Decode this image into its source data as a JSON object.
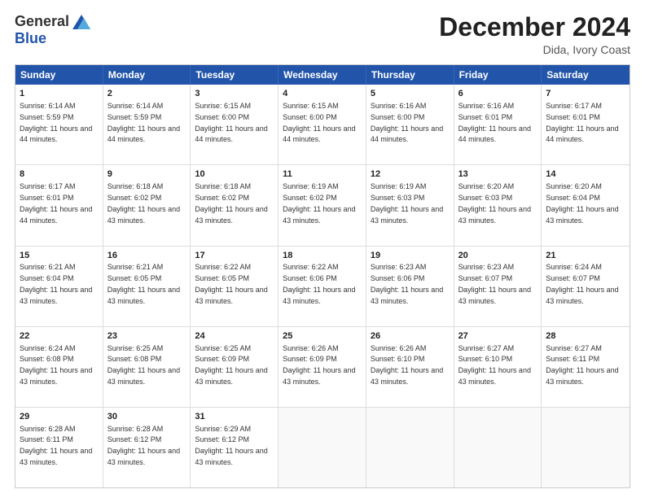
{
  "logo": {
    "general": "General",
    "blue": "Blue"
  },
  "title": "December 2024",
  "location": "Dida, Ivory Coast",
  "days": [
    "Sunday",
    "Monday",
    "Tuesday",
    "Wednesday",
    "Thursday",
    "Friday",
    "Saturday"
  ],
  "weeks": [
    [
      {
        "day": "1",
        "sunrise": "6:14 AM",
        "sunset": "5:59 PM",
        "daylight": "11 hours and 44 minutes."
      },
      {
        "day": "2",
        "sunrise": "6:14 AM",
        "sunset": "5:59 PM",
        "daylight": "11 hours and 44 minutes."
      },
      {
        "day": "3",
        "sunrise": "6:15 AM",
        "sunset": "6:00 PM",
        "daylight": "11 hours and 44 minutes."
      },
      {
        "day": "4",
        "sunrise": "6:15 AM",
        "sunset": "6:00 PM",
        "daylight": "11 hours and 44 minutes."
      },
      {
        "day": "5",
        "sunrise": "6:16 AM",
        "sunset": "6:00 PM",
        "daylight": "11 hours and 44 minutes."
      },
      {
        "day": "6",
        "sunrise": "6:16 AM",
        "sunset": "6:01 PM",
        "daylight": "11 hours and 44 minutes."
      },
      {
        "day": "7",
        "sunrise": "6:17 AM",
        "sunset": "6:01 PM",
        "daylight": "11 hours and 44 minutes."
      }
    ],
    [
      {
        "day": "8",
        "sunrise": "6:17 AM",
        "sunset": "6:01 PM",
        "daylight": "11 hours and 44 minutes."
      },
      {
        "day": "9",
        "sunrise": "6:18 AM",
        "sunset": "6:02 PM",
        "daylight": "11 hours and 43 minutes."
      },
      {
        "day": "10",
        "sunrise": "6:18 AM",
        "sunset": "6:02 PM",
        "daylight": "11 hours and 43 minutes."
      },
      {
        "day": "11",
        "sunrise": "6:19 AM",
        "sunset": "6:02 PM",
        "daylight": "11 hours and 43 minutes."
      },
      {
        "day": "12",
        "sunrise": "6:19 AM",
        "sunset": "6:03 PM",
        "daylight": "11 hours and 43 minutes."
      },
      {
        "day": "13",
        "sunrise": "6:20 AM",
        "sunset": "6:03 PM",
        "daylight": "11 hours and 43 minutes."
      },
      {
        "day": "14",
        "sunrise": "6:20 AM",
        "sunset": "6:04 PM",
        "daylight": "11 hours and 43 minutes."
      }
    ],
    [
      {
        "day": "15",
        "sunrise": "6:21 AM",
        "sunset": "6:04 PM",
        "daylight": "11 hours and 43 minutes."
      },
      {
        "day": "16",
        "sunrise": "6:21 AM",
        "sunset": "6:05 PM",
        "daylight": "11 hours and 43 minutes."
      },
      {
        "day": "17",
        "sunrise": "6:22 AM",
        "sunset": "6:05 PM",
        "daylight": "11 hours and 43 minutes."
      },
      {
        "day": "18",
        "sunrise": "6:22 AM",
        "sunset": "6:06 PM",
        "daylight": "11 hours and 43 minutes."
      },
      {
        "day": "19",
        "sunrise": "6:23 AM",
        "sunset": "6:06 PM",
        "daylight": "11 hours and 43 minutes."
      },
      {
        "day": "20",
        "sunrise": "6:23 AM",
        "sunset": "6:07 PM",
        "daylight": "11 hours and 43 minutes."
      },
      {
        "day": "21",
        "sunrise": "6:24 AM",
        "sunset": "6:07 PM",
        "daylight": "11 hours and 43 minutes."
      }
    ],
    [
      {
        "day": "22",
        "sunrise": "6:24 AM",
        "sunset": "6:08 PM",
        "daylight": "11 hours and 43 minutes."
      },
      {
        "day": "23",
        "sunrise": "6:25 AM",
        "sunset": "6:08 PM",
        "daylight": "11 hours and 43 minutes."
      },
      {
        "day": "24",
        "sunrise": "6:25 AM",
        "sunset": "6:09 PM",
        "daylight": "11 hours and 43 minutes."
      },
      {
        "day": "25",
        "sunrise": "6:26 AM",
        "sunset": "6:09 PM",
        "daylight": "11 hours and 43 minutes."
      },
      {
        "day": "26",
        "sunrise": "6:26 AM",
        "sunset": "6:10 PM",
        "daylight": "11 hours and 43 minutes."
      },
      {
        "day": "27",
        "sunrise": "6:27 AM",
        "sunset": "6:10 PM",
        "daylight": "11 hours and 43 minutes."
      },
      {
        "day": "28",
        "sunrise": "6:27 AM",
        "sunset": "6:11 PM",
        "daylight": "11 hours and 43 minutes."
      }
    ],
    [
      {
        "day": "29",
        "sunrise": "6:28 AM",
        "sunset": "6:11 PM",
        "daylight": "11 hours and 43 minutes."
      },
      {
        "day": "30",
        "sunrise": "6:28 AM",
        "sunset": "6:12 PM",
        "daylight": "11 hours and 43 minutes."
      },
      {
        "day": "31",
        "sunrise": "6:29 AM",
        "sunset": "6:12 PM",
        "daylight": "11 hours and 43 minutes."
      },
      null,
      null,
      null,
      null
    ]
  ]
}
